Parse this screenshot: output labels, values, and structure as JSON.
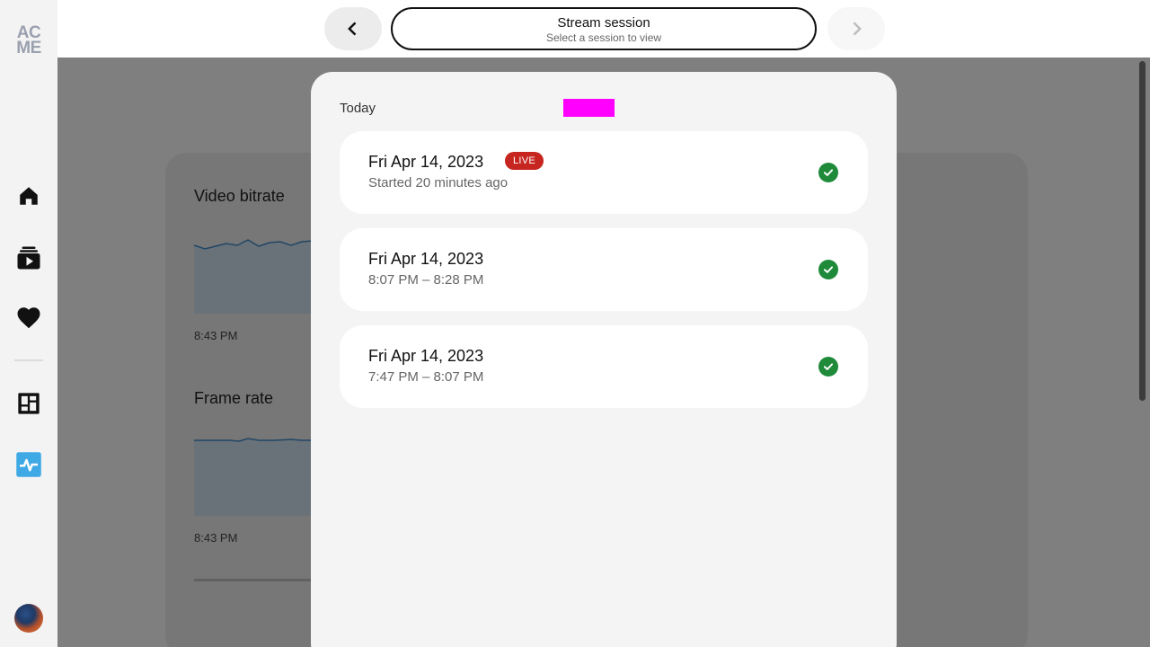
{
  "logo": {
    "line1": "AC",
    "line2": "ME"
  },
  "sidebar": {
    "items": [
      {
        "name": "home",
        "icon": "home-icon"
      },
      {
        "name": "videos",
        "icon": "video-library-icon"
      },
      {
        "name": "favorites",
        "icon": "heart-icon"
      },
      {
        "name": "dashboard",
        "icon": "dashboard-icon"
      },
      {
        "name": "monitoring",
        "icon": "activity-icon",
        "active": true,
        "accent": "#3fa9e6"
      }
    ],
    "avatar": "user-avatar"
  },
  "header": {
    "prev_icon": "chevron-left-icon",
    "next_icon": "chevron-right-icon",
    "session_title": "Stream session",
    "session_subtitle": "Select a session to view"
  },
  "dashboard": {
    "metrics": [
      {
        "title": "Video bitrate",
        "time": "8:43 PM"
      },
      {
        "title": "Frame rate",
        "time": "8:43 PM"
      }
    ]
  },
  "modal": {
    "group_label": "Today",
    "sessions": [
      {
        "date": "Fri Apr 14, 2023",
        "badge": "LIVE",
        "subtitle": "Started 20 minutes ago",
        "status": "check-circle-icon"
      },
      {
        "date": "Fri Apr 14, 2023",
        "badge": "",
        "subtitle": "8:07 PM – 8:28 PM",
        "status": "check-circle-icon"
      },
      {
        "date": "Fri Apr 14, 2023",
        "badge": "",
        "subtitle": "7:47 PM – 8:07 PM",
        "status": "check-circle-icon"
      }
    ]
  },
  "colors": {
    "live": "#c7251f",
    "success": "#1e8a3a",
    "accent": "#3fa9e6",
    "logo": "#9aa0ae"
  }
}
